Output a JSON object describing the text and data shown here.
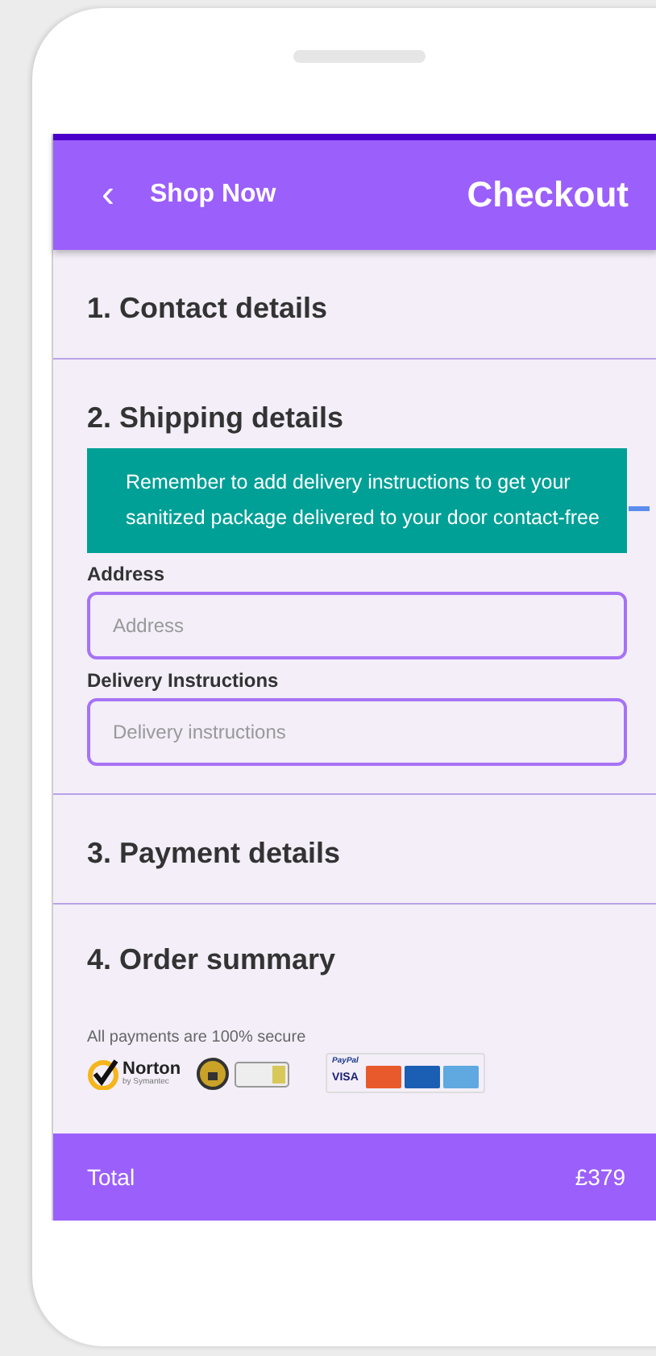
{
  "header": {
    "back_icon": "‹",
    "back_label": "Shop Now",
    "title": "Checkout"
  },
  "sections": [
    {
      "kind": "plain",
      "title": "1. Contact details"
    },
    {
      "kind": "form",
      "title": "2. Shipping details",
      "notice": "Remember to add delivery instructions to get your sanitized package delivered to your door contact-free",
      "fields": [
        {
          "label": "Address",
          "placeholder": "Address"
        },
        {
          "label": "Delivery Instructions",
          "placeholder": "Delivery instructions"
        }
      ]
    },
    {
      "kind": "plain",
      "title": "3. Payment details"
    },
    {
      "kind": "summary",
      "title": "4. Order summary",
      "secure_note": "All payments are 100% secure",
      "badges": [
        {
          "kind": "norton",
          "label": "Norton",
          "sub": "by Symantec"
        },
        {
          "kind": "ssl"
        },
        {
          "kind": "cards",
          "label": "PayPal",
          "card": "VISA"
        }
      ]
    }
  ],
  "footer": {
    "label": "Total",
    "amount": "£379"
  }
}
